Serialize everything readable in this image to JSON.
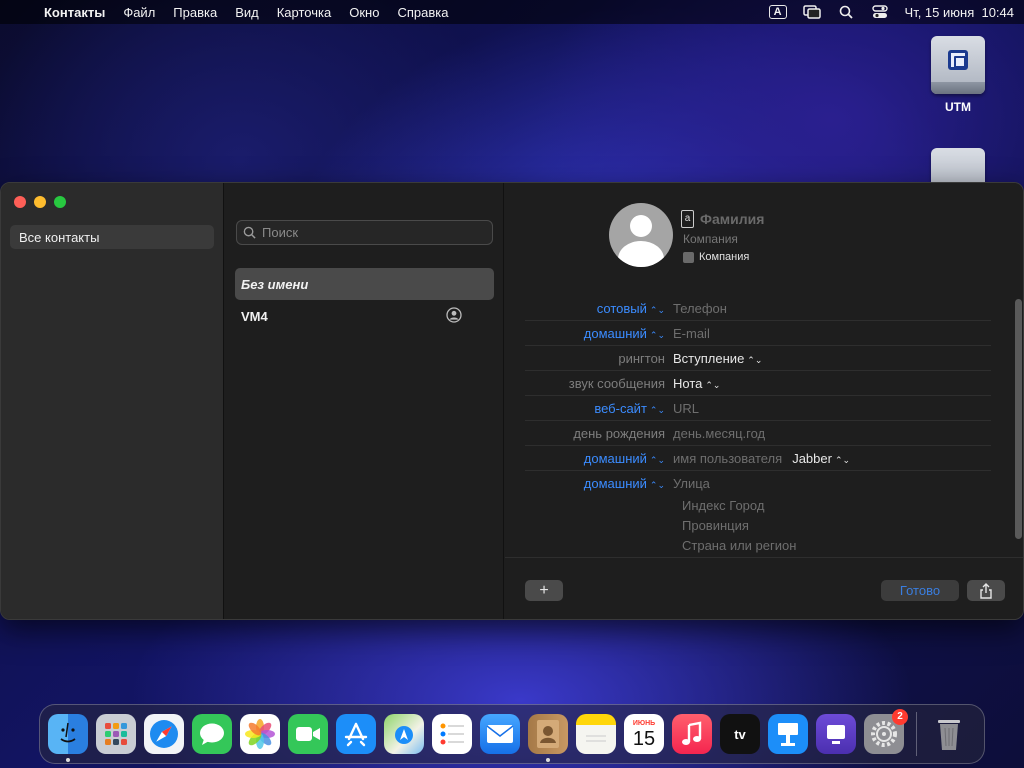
{
  "menubar": {
    "app_name": "Контакты",
    "items": [
      "Файл",
      "Правка",
      "Вид",
      "Карточка",
      "Окно",
      "Справка"
    ],
    "input_indicator": "A",
    "datetime": "Чт, 15 июня  10:44"
  },
  "desktop": {
    "icons": [
      {
        "label": "UTM",
        "icon": "disk-icon"
      }
    ]
  },
  "sidebar": {
    "items": [
      {
        "label": "Все контакты",
        "selected": true
      }
    ]
  },
  "contacts_list": {
    "search_placeholder": "Поиск",
    "items": [
      {
        "name": "Без имени",
        "selected": true
      },
      {
        "name": "VM4",
        "is_me": true
      }
    ]
  },
  "detail": {
    "name_placeholder": "Фамилия",
    "company_placeholder": "Компания",
    "company_checkbox_label": "Компания",
    "fields": [
      {
        "label": "сотовый",
        "value": "Телефон"
      },
      {
        "label": "домашний",
        "value": "E-mail"
      },
      {
        "label": "рингтон",
        "value": "Вступление"
      },
      {
        "label": "звук сообщения",
        "value": "Нота"
      },
      {
        "label": "веб-сайт",
        "value": "URL"
      },
      {
        "label": "день рождения",
        "value": "день.месяц.год"
      },
      {
        "label": "домашний",
        "value": "имя пользователя",
        "service": "Jabber"
      },
      {
        "label": "домашний",
        "value": "Улица"
      }
    ],
    "address_lines": [
      "Индекс Город",
      "Провинция",
      "Страна или регион"
    ],
    "add_button": "+",
    "done_button": "Готово"
  },
  "dock": {
    "apps": [
      "Finder",
      "Launchpad",
      "Safari",
      "Сообщения",
      "Фото",
      "FaceTime",
      "App Store",
      "Карты",
      "Напоминания",
      "Почта",
      "Контакты",
      "Заметки",
      "Календарь",
      "Музыка",
      "TV",
      "Keynote",
      "Утилита",
      "Системные настройки"
    ],
    "calendar_month": "ИЮНЬ",
    "calendar_day": "15",
    "settings_badge": "2"
  },
  "colors": {
    "accent_blue": "#3b8cff",
    "window_bg": "#1e1e1e",
    "sidebar_bg": "#2b2b2b"
  }
}
